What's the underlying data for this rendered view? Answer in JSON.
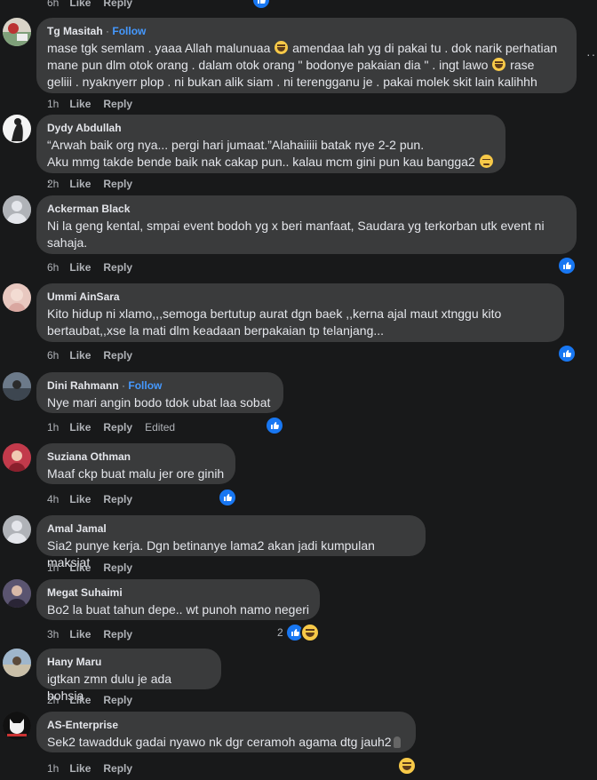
{
  "colors": {
    "background": "#18191a",
    "bubble": "#3a3b3c",
    "link": "#4599ff",
    "like": "#1877f2",
    "muted": "#b0b3b8"
  },
  "top_partial": {
    "time": "6h",
    "like": "Like",
    "reply": "Reply"
  },
  "comments": [
    {
      "name": "Tg Masitah",
      "follow": "Follow",
      "text_parts": [
        "mase tgk semlam . yaaa Allah malunuaa ",
        " amendaa lah yg di pakai tu . dok narik perhatian\nmane pun dlm otok orang . dalam otok orang \" bodonye pakaian dia \" . ingt lawo ",
        " rase\ngeliii . nyaknyerr plop . ni bukan alik siam . ni terengganu je . pakai molek skit lain kalihhh"
      ],
      "time": "1h",
      "like": "Like",
      "reply": "Reply"
    },
    {
      "name": "Dydy Abdullah",
      "text_parts": [
        "“Arwah baik org nya... pergi hari jumaat.”Alahaiiiii batak nye 2-2 pun.\nAku mmg takde bende baik nak cakap pun.. kalau mcm gini pun kau bangga2 ",
        "."
      ],
      "time": "2h",
      "like": "Like",
      "reply": "Reply"
    },
    {
      "name": "Ackerman Black",
      "text": "Ni la geng kental, smpai event bodoh yg x beri manfaat, Saudara yg terkorban utk event ni\nsahaja.",
      "time": "6h",
      "like": "Like",
      "reply": "Reply"
    },
    {
      "name": "Ummi AinSara",
      "text": "Kito hidup ni xlamo,,,semoga bertutup aurat dgn baek ,,kerna ajal maut xtnggu kito\nbertaubat,,xse la mati dlm keadaan berpakaian tp telanjang...",
      "time": "6h",
      "like": "Like",
      "reply": "Reply"
    },
    {
      "name": "Dini Rahmann",
      "follow": "Follow",
      "text": "Nye mari angin bodo tdok ubat laa sobat",
      "time": "1h",
      "like": "Like",
      "reply": "Reply",
      "edited": "Edited"
    },
    {
      "name": "Suziana Othman",
      "text": "Maaf ckp buat malu jer ore ginih",
      "time": "4h",
      "like": "Like",
      "reply": "Reply"
    },
    {
      "name": "Amal Jamal",
      "text": "Sia2 punye kerja. Dgn betinanye lama2 akan jadi kumpulan maksiat",
      "time": "1h",
      "like": "Like",
      "reply": "Reply"
    },
    {
      "name": "Megat Suhaimi",
      "text": "Bo2 la buat tahun depe.. wt punoh namo negeri",
      "time": "3h",
      "like": "Like",
      "reply": "Reply",
      "reaction_count": "2"
    },
    {
      "name": "Hany Maru",
      "text": "igtkan zmn dulu je ada bohsia",
      "time": "2h",
      "like": "Like",
      "reply": "Reply"
    },
    {
      "name": "AS-Enterprise",
      "text": "Sek2 tawadduk gadai nyawo nk dgr ceramoh agama dtg jauh2",
      "time": "1h",
      "like": "Like",
      "reply": "Reply"
    }
  ]
}
